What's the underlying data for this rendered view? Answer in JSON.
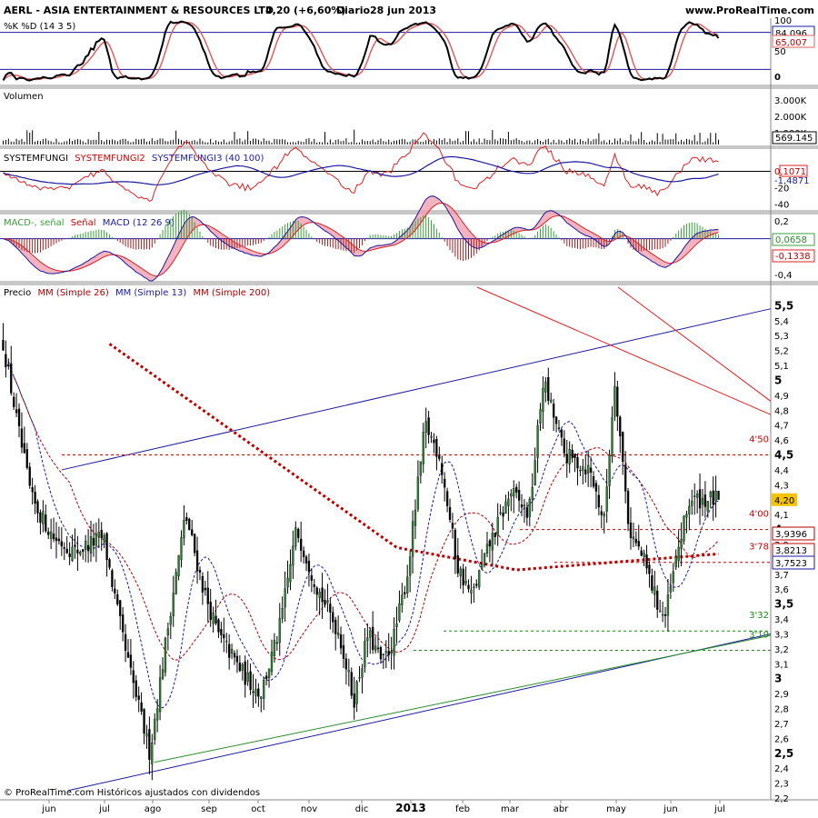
{
  "header": {
    "title": "AERL - ASIA ENTERTAINMENT & RESOURCES LTD",
    "quote": "4,20 (+6,60%)",
    "period": "Diario",
    "date": "28 jun 2013",
    "site": "www.ProRealTime.com"
  },
  "footer": "© ProRealTime.com Históricos ajustados con dividendos",
  "colors": {
    "up": "#2e7d32",
    "down": "#000000",
    "ma26": "#b00000",
    "ma13": "#1a1aa0",
    "ma200": "#c00000",
    "trend_blue": "#1a1aa0",
    "trend_red": "#e02020",
    "level_red": "#cc0000",
    "level_green": "#1a8a1a",
    "macd_fill_up": "#7ad07a",
    "macd_fill_down": "#f0a0b0",
    "price_badge": "#f5c400"
  },
  "chart_data": [
    {
      "id": "stochastic",
      "type": "line",
      "title": "%K %D (14 3 5)",
      "series": [
        {
          "name": "%K"
        },
        {
          "name": "%D"
        }
      ],
      "ylim": [
        0,
        100
      ],
      "ticks": [
        "100",
        "50",
        "0"
      ],
      "last_values": [
        "84,096",
        "65,007"
      ]
    },
    {
      "id": "volume",
      "type": "bar",
      "title": "Volumen",
      "ticks": [
        "3.000K",
        "2.000K",
        "1.000K"
      ],
      "last_values": [
        "569.145"
      ]
    },
    {
      "id": "systemfungi",
      "type": "line",
      "title_parts": [
        "SYSTEMFUNGI",
        "SYSTEMFUNGI2",
        "SYSTEMFUNGI3 (40 100)"
      ],
      "series": [
        {
          "name": "SYSTEMFUNGI"
        },
        {
          "name": "SYSTEMFUNGI2"
        },
        {
          "name": "SYSTEMFUNGI3"
        }
      ],
      "ylim": [
        -45,
        25
      ],
      "ticks": [
        "-20",
        "-40"
      ],
      "last_values": [
        "0,1071",
        "-1,4871"
      ]
    },
    {
      "id": "macd",
      "type": "line",
      "title_parts": [
        "MACD-, señal",
        "Señal",
        "MACD (12 26 9)"
      ],
      "series": [
        {
          "name": "MACD-, señal"
        },
        {
          "name": "Señal"
        },
        {
          "name": "MACD"
        }
      ],
      "ylim": [
        -0.45,
        0.25
      ],
      "ticks": [
        "0,2",
        "0",
        "-0,2",
        "-0,4"
      ],
      "last_values": [
        "0,0658",
        "-0,1338"
      ]
    },
    {
      "id": "price",
      "type": "candlestick",
      "title": "Precio",
      "series": [
        {
          "name": "MM (Simple 26)"
        },
        {
          "name": "MM (Simple 13)"
        },
        {
          "name": "MM (Simple 200)"
        }
      ],
      "ylim": [
        2.2,
        5.6
      ],
      "y_ticks": [
        "5,5",
        "5,4",
        "5,3",
        "5,2",
        "5,1",
        "5",
        "4,9",
        "4,8",
        "4,7",
        "4,6",
        "4,5",
        "4,4",
        "4,3",
        "4,2",
        "4,1",
        "4",
        "3,9",
        "3,8",
        "3,7",
        "3,6",
        "3,5",
        "3,4",
        "3,3",
        "3,2",
        "3,1",
        "3",
        "2,9",
        "2,8",
        "2,7",
        "2,6",
        "2,5",
        "2,4",
        "2,3",
        "2,2"
      ],
      "x_ticks": [
        "jun",
        "jul",
        "ago",
        "sep",
        "oct",
        "nov",
        "dic",
        "2013",
        "feb",
        "mar",
        "abr",
        "may",
        "jun",
        "jul"
      ],
      "last_price": "4,20",
      "last_values": [
        {
          "label": "3,9396",
          "series": "MM (Simple 26)"
        },
        {
          "label": "3,8213",
          "series": "MM (Simple 200)"
        },
        {
          "label": "3,7523",
          "series": "MM (Simple 13)"
        }
      ],
      "levels": [
        {
          "label": "4'50",
          "value": 4.5,
          "color": "red"
        },
        {
          "label": "4'00",
          "value": 4.0,
          "color": "red"
        },
        {
          "label": "3'78",
          "value": 3.78,
          "color": "red"
        },
        {
          "label": "3'32",
          "value": 3.32,
          "color": "green"
        },
        {
          "label": "3'19",
          "value": 3.19,
          "color": "green"
        }
      ],
      "key_points": [
        {
          "t": 0.0,
          "v": 5.25
        },
        {
          "t": 0.02,
          "v": 4.7
        },
        {
          "t": 0.04,
          "v": 4.2
        },
        {
          "t": 0.07,
          "v": 3.95
        },
        {
          "t": 0.1,
          "v": 3.85
        },
        {
          "t": 0.14,
          "v": 3.95
        },
        {
          "t": 0.17,
          "v": 3.2
        },
        {
          "t": 0.205,
          "v": 2.5
        },
        {
          "t": 0.235,
          "v": 3.5
        },
        {
          "t": 0.255,
          "v": 4.1
        },
        {
          "t": 0.28,
          "v": 3.6
        },
        {
          "t": 0.3,
          "v": 3.3
        },
        {
          "t": 0.34,
          "v": 3.0
        },
        {
          "t": 0.36,
          "v": 2.9
        },
        {
          "t": 0.385,
          "v": 3.3
        },
        {
          "t": 0.41,
          "v": 4.0
        },
        {
          "t": 0.44,
          "v": 3.6
        },
        {
          "t": 0.47,
          "v": 3.3
        },
        {
          "t": 0.49,
          "v": 2.85
        },
        {
          "t": 0.51,
          "v": 3.3
        },
        {
          "t": 0.53,
          "v": 3.1
        },
        {
          "t": 0.545,
          "v": 3.25
        },
        {
          "t": 0.565,
          "v": 3.7
        },
        {
          "t": 0.59,
          "v": 4.7
        },
        {
          "t": 0.61,
          "v": 4.5
        },
        {
          "t": 0.635,
          "v": 3.75
        },
        {
          "t": 0.655,
          "v": 3.55
        },
        {
          "t": 0.68,
          "v": 3.9
        },
        {
          "t": 0.71,
          "v": 4.25
        },
        {
          "t": 0.735,
          "v": 4.1
        },
        {
          "t": 0.755,
          "v": 5.0
        },
        {
          "t": 0.785,
          "v": 4.5
        },
        {
          "t": 0.82,
          "v": 4.4
        },
        {
          "t": 0.84,
          "v": 4.05
        },
        {
          "t": 0.855,
          "v": 5.0
        },
        {
          "t": 0.875,
          "v": 4.0
        },
        {
          "t": 0.895,
          "v": 3.8
        },
        {
          "t": 0.915,
          "v": 3.5
        },
        {
          "t": 0.925,
          "v": 3.4
        },
        {
          "t": 0.945,
          "v": 3.9
        },
        {
          "t": 0.96,
          "v": 4.2
        }
      ]
    }
  ]
}
